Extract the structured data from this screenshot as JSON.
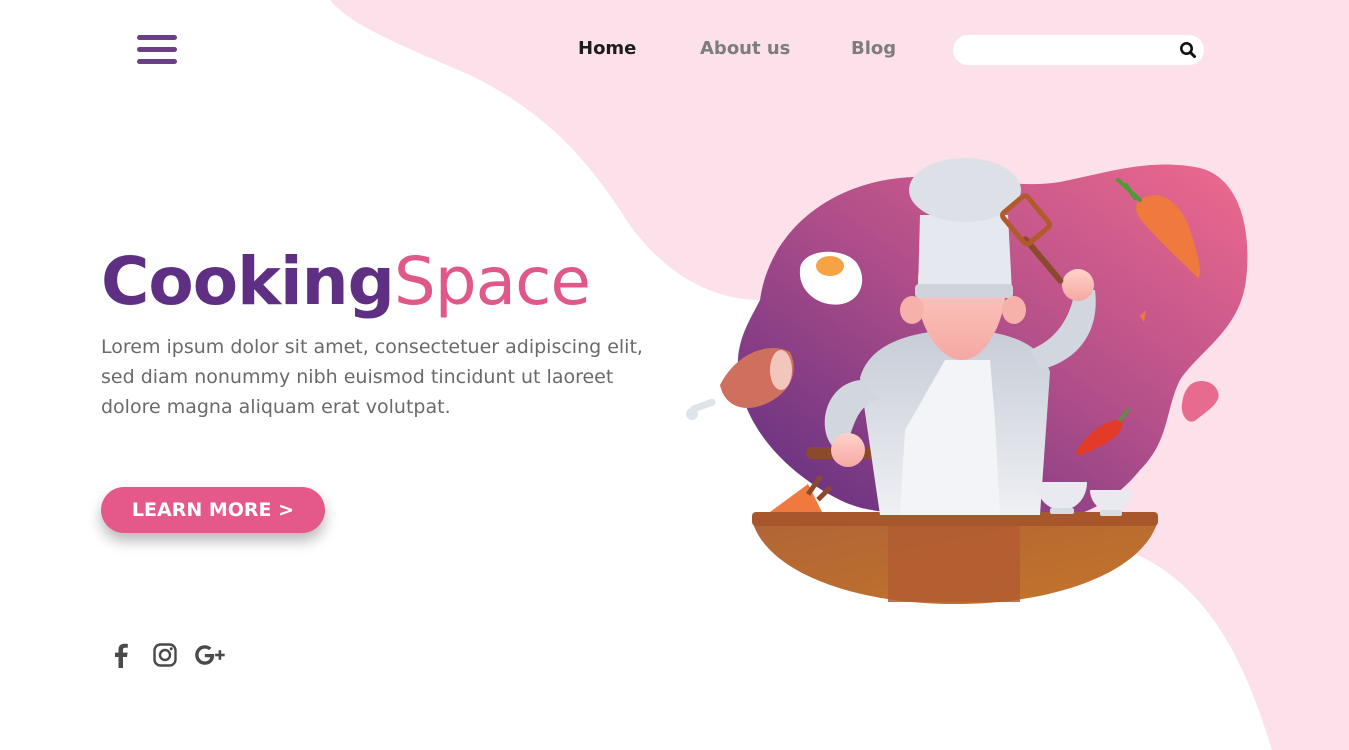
{
  "nav": {
    "items": [
      {
        "label": "Home",
        "active": true
      },
      {
        "label": "About us",
        "active": false
      },
      {
        "label": "Blog",
        "active": false
      }
    ]
  },
  "search": {
    "placeholder": "",
    "value": "",
    "icon": "search-icon"
  },
  "hero": {
    "title_part1": "Cooking",
    "title_part2": "Space",
    "description": "Lorem ipsum dolor sit amet, consectetuer adipiscing elit, sed diam nonummy nibh euismod tincidunt ut laoreet dolore magna aliquam erat volutpat.",
    "cta_label": "LEARN MORE",
    "cta_arrow": ">"
  },
  "social": [
    "facebook-icon",
    "instagram-icon",
    "google-plus-icon"
  ],
  "colors": {
    "primary_purple": "#5e2f82",
    "accent_pink": "#e5588a",
    "blob_pink": "#fde1ea",
    "text_gray": "#6a6a6a"
  }
}
